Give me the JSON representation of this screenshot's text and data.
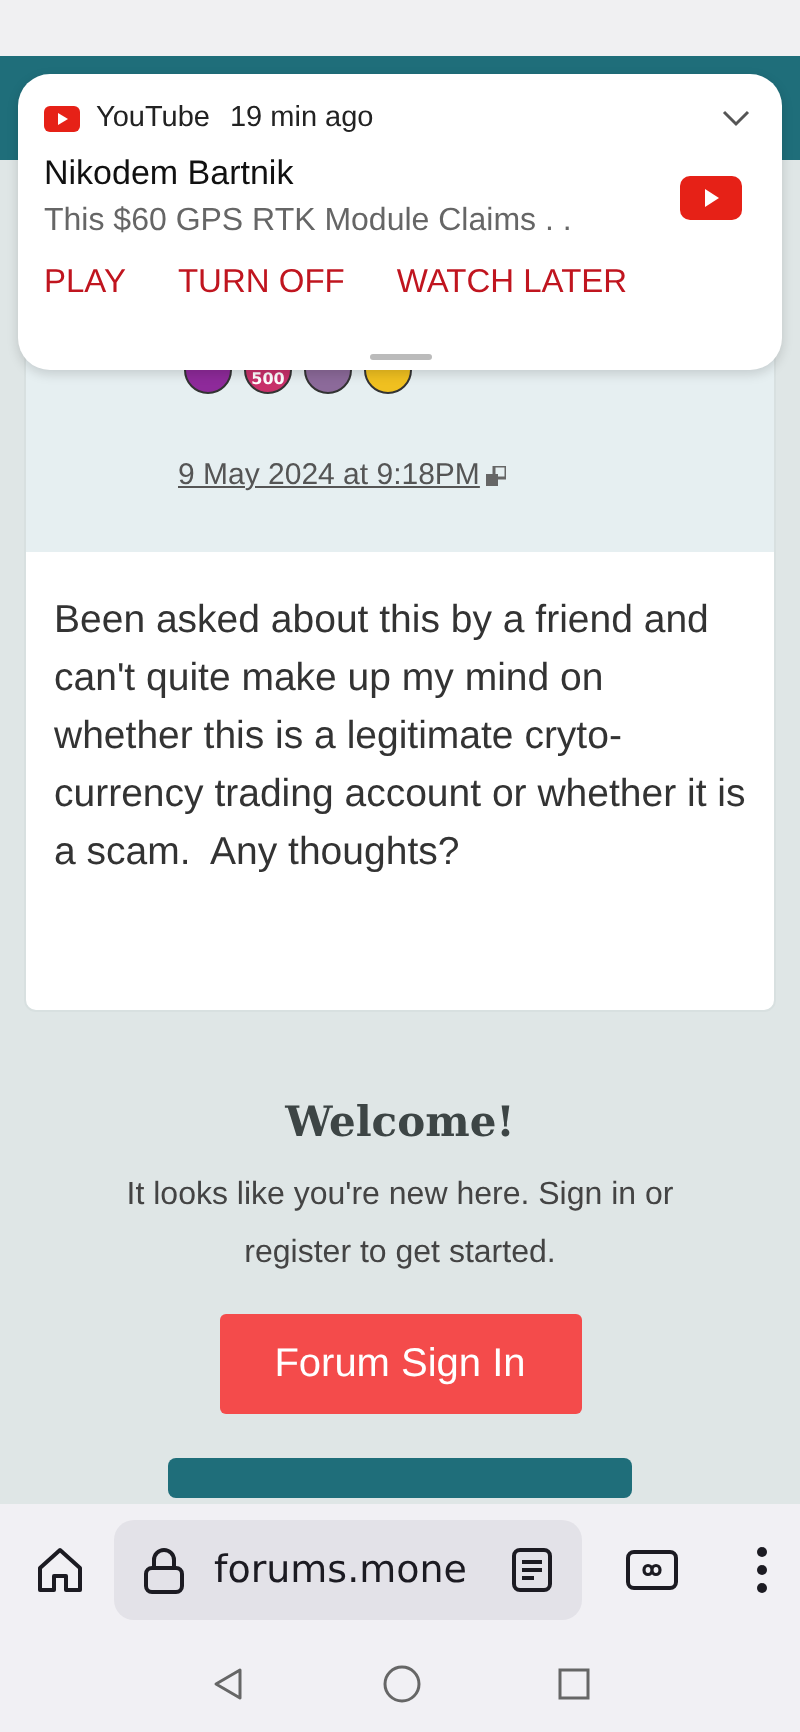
{
  "notification": {
    "app": "YouTube",
    "time": "19 min ago",
    "title": "Nikodem Bartnik",
    "text": "This $60 GPS RTK Module Claims . .",
    "actions": [
      "PLAY",
      "TURN OFF",
      "WATCH LATER"
    ]
  },
  "post": {
    "badges": [
      {
        "color": "#8e2a9a"
      },
      {
        "color": "#c8306a",
        "label": "500"
      },
      {
        "color": "#8c6a9a"
      },
      {
        "color": "#f0c020"
      }
    ],
    "date": "9 May 2024 at 9:18PM",
    "body": "Been asked about this by a friend and can't quite make up my mind on whether this is a legitimate cryto-currency trading account or whether it is a scam.  Any thoughts?"
  },
  "welcome": {
    "title": "Welcome!",
    "text": "It looks like you're new here. Sign in or register to get started.",
    "button": "Forum Sign In"
  },
  "browser": {
    "url": "forums.mone"
  }
}
